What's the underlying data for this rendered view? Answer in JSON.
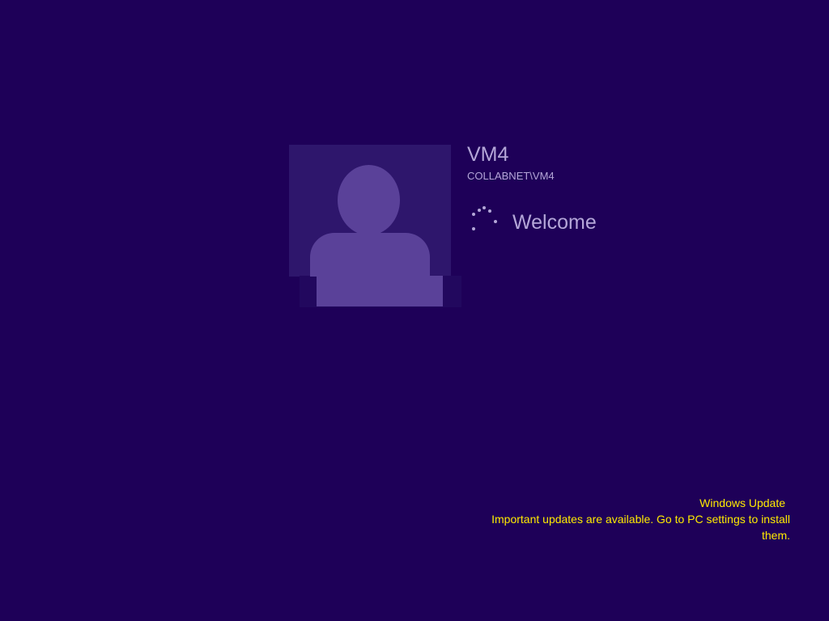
{
  "user": {
    "name": "VM4",
    "domain_account": "COLLABNET\\VM4"
  },
  "status": {
    "text": "Welcome",
    "spinner_icon": "loading-spinner-icon"
  },
  "avatar": {
    "icon": "user-silhouette-icon"
  },
  "notification": {
    "title": "Windows Update",
    "message": "Important updates are available. Go to PC settings to install them."
  },
  "colors": {
    "background": "#1e0058",
    "tile": "#2e166c",
    "silhouette": "#5a4199",
    "text": "#b4a6d8",
    "notice": "#ffea00"
  }
}
